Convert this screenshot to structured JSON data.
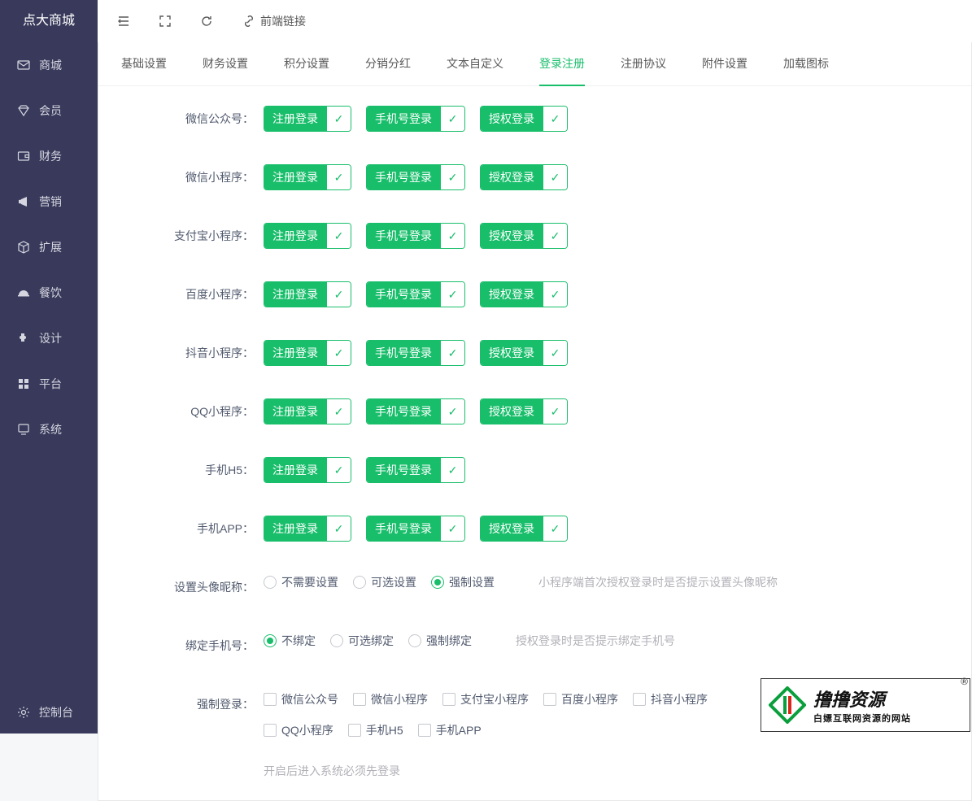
{
  "brand": "点大商城",
  "sidebar": {
    "items": [
      {
        "label": "商城",
        "icon": "mail"
      },
      {
        "label": "会员",
        "icon": "diamond"
      },
      {
        "label": "财务",
        "icon": "wallet"
      },
      {
        "label": "营销",
        "icon": "megaphone"
      },
      {
        "label": "扩展",
        "icon": "cube"
      },
      {
        "label": "餐饮",
        "icon": "dish"
      },
      {
        "label": "设计",
        "icon": "puzzle"
      },
      {
        "label": "平台",
        "icon": "grid"
      },
      {
        "label": "系统",
        "icon": "monitor"
      }
    ],
    "bottom": {
      "label": "控制台",
      "icon": "gear"
    }
  },
  "topbar": {
    "frontend_link": "前端链接"
  },
  "tabs": [
    "基础设置",
    "财务设置",
    "积分设置",
    "分销分红",
    "文本自定义",
    "登录注册",
    "注册协议",
    "附件设置",
    "加载图标"
  ],
  "active_tab_index": 5,
  "toggles": {
    "register": "注册登录",
    "phone": "手机号登录",
    "auth": "授权登录"
  },
  "platform_rows": [
    {
      "label": "微信公众号：",
      "has_auth": true
    },
    {
      "label": "微信小程序：",
      "has_auth": true
    },
    {
      "label": "支付宝小程序：",
      "has_auth": true
    },
    {
      "label": "百度小程序：",
      "has_auth": true
    },
    {
      "label": "抖音小程序：",
      "has_auth": true
    },
    {
      "label": "QQ小程序：",
      "has_auth": true
    },
    {
      "label": "手机H5：",
      "has_auth": false
    },
    {
      "label": "手机APP：",
      "has_auth": true
    }
  ],
  "avatar": {
    "label": "设置头像昵称：",
    "options": [
      "不需要设置",
      "可选设置",
      "强制设置"
    ],
    "selected": 2,
    "hint": "小程序端首次授权登录时是否提示设置头像昵称"
  },
  "bind_phone": {
    "label": "绑定手机号：",
    "options": [
      "不绑定",
      "可选绑定",
      "强制绑定"
    ],
    "selected": 0,
    "hint": "授权登录时是否提示绑定手机号"
  },
  "force_login": {
    "label": "强制登录：",
    "options": [
      "微信公众号",
      "微信小程序",
      "支付宝小程序",
      "百度小程序",
      "抖音小程序",
      "QQ小程序",
      "手机H5",
      "手机APP"
    ],
    "hint": "开启后进入系统必须先登录"
  },
  "watermark": {
    "main": "撸撸资源",
    "sub": "白嫖互联网资源的网站",
    "r": "®"
  }
}
